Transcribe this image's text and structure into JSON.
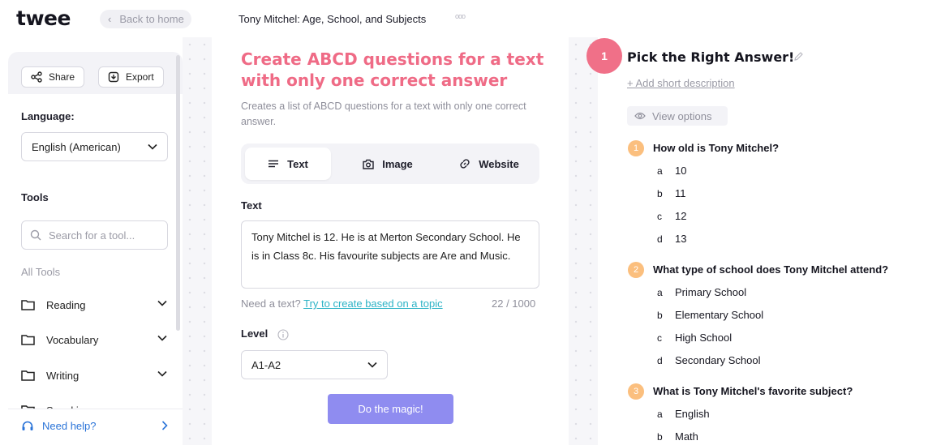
{
  "app": {
    "logo": "twee",
    "back_label": "Back to home",
    "doc_title": "Tony Mitchel: Age, School, and Subjects"
  },
  "sidebar": {
    "share_label": "Share",
    "export_label": "Export",
    "language_label": "Language:",
    "language_value": "English (American)",
    "tools_label": "Tools",
    "search_placeholder": "Search for a tool...",
    "all_tools_label": "All Tools",
    "categories": [
      {
        "label": "Reading"
      },
      {
        "label": "Vocabulary"
      },
      {
        "label": "Writing"
      },
      {
        "label": "Speaking"
      }
    ],
    "help_label": "Need help?"
  },
  "main": {
    "title": "Create ABCD questions for a text with only one correct answer",
    "description": "Creates a list of ABCD questions for a text with only one correct answer.",
    "tabs": [
      {
        "label": "Text",
        "icon": "lines-icon",
        "active": true
      },
      {
        "label": "Image",
        "icon": "camera-icon",
        "active": false
      },
      {
        "label": "Website",
        "icon": "link-icon",
        "active": false
      }
    ],
    "text_label": "Text",
    "text_value": "Tony Mitchel is 12. He is at Merton Secondary School. He is in Class 8c. His favourite subjects are Are and Music.",
    "hint_text": "Need a text?",
    "hint_link": "Try to create based on a topic",
    "counter": "22 / 1000",
    "level_label": "Level",
    "level_value": "A1-A2",
    "magic_button": "Do the magic!"
  },
  "quiz": {
    "number": "1",
    "title": "Pick the Right Answer!",
    "add_description": "+ Add short description",
    "view_options": "View options",
    "questions": [
      {
        "number": "1",
        "text": "How old is Tony Mitchel?",
        "options": [
          {
            "letter": "a",
            "text": "10"
          },
          {
            "letter": "b",
            "text": "11"
          },
          {
            "letter": "c",
            "text": "12"
          },
          {
            "letter": "d",
            "text": "13"
          }
        ]
      },
      {
        "number": "2",
        "text": "What type of school does Tony Mitchel attend?",
        "options": [
          {
            "letter": "a",
            "text": "Primary School"
          },
          {
            "letter": "b",
            "text": "Elementary School"
          },
          {
            "letter": "c",
            "text": "High School"
          },
          {
            "letter": "d",
            "text": "Secondary School"
          }
        ]
      },
      {
        "number": "3",
        "text": "What is Tony Mitchel's favorite subject?",
        "options": [
          {
            "letter": "a",
            "text": "English"
          },
          {
            "letter": "b",
            "text": "Math"
          }
        ]
      }
    ]
  },
  "colors": {
    "accent_pink": "#ef6b86",
    "accent_purple": "#8f8cf0",
    "badge_orange": "#fbbf7e",
    "link_teal": "#2db3c6",
    "help_blue": "#2b74d8"
  }
}
